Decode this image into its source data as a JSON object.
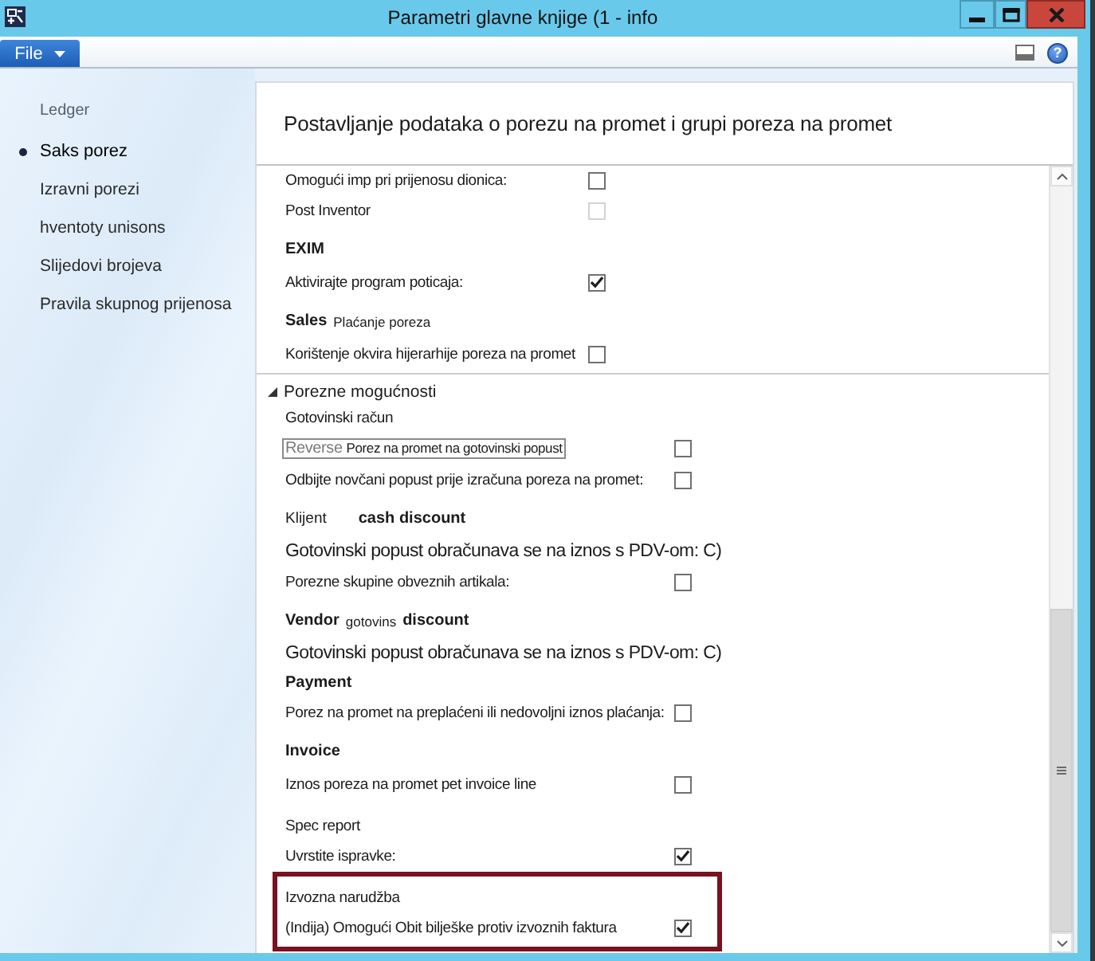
{
  "window": {
    "title": "Parametri glavne knjige (1 - info"
  },
  "ribbon": {
    "file_button": "File",
    "help_button": "?"
  },
  "sidebar": {
    "heading": "Ledger",
    "items": [
      {
        "label": "Saks porez",
        "selected": true
      },
      {
        "label": "Izravni porezi",
        "selected": false
      },
      {
        "label": "hventoty unisons",
        "selected": false
      },
      {
        "label": "Slijedovi brojeva",
        "selected": false
      },
      {
        "label": "Pravila skupnog prijenosa",
        "selected": false
      }
    ]
  },
  "content": {
    "title": "Postavljanje podataka o porezu na promet i grupi poreza na promet",
    "rows": [
      {
        "kind": "checkbox",
        "label": "Omogući imp pri prijenosu dionica:",
        "checked": false,
        "disabled": false,
        "focused": false
      },
      {
        "kind": "checkbox",
        "label": "Post Inventor",
        "checked": false,
        "disabled": true,
        "focused": false
      },
      {
        "kind": "heading",
        "parts": [
          {
            "kind": "title",
            "text": "EXIM"
          }
        ]
      },
      {
        "kind": "checkbox",
        "label": "Aktivirajte program poticaja:",
        "checked": true,
        "disabled": false,
        "focused": false
      },
      {
        "kind": "heading",
        "parts": [
          {
            "kind": "title",
            "text": "Sales"
          },
          {
            "kind": "caption",
            "text": "Plaćanje poreza"
          }
        ]
      },
      {
        "kind": "checkbox",
        "label": "Korištenje okvira hijerarhije poreza na promet",
        "checked": false,
        "disabled": false,
        "focused": false
      }
    ],
    "group": {
      "title": "Porezne mogućnosti",
      "expanded": true,
      "rows": [
        {
          "kind": "text",
          "text": "Gotovinski račun"
        },
        {
          "kind": "checkbox",
          "prefix": "Reverse",
          "label": "Porez na promet na gotovinski popust",
          "checked": false,
          "disabled": false,
          "focused": true
        },
        {
          "kind": "checkbox",
          "label": "Odbijte novčani popust prije izračuna poreza na promet:",
          "checked": false,
          "disabled": false,
          "focused": false
        },
        {
          "kind": "heading",
          "parts": [
            {
              "kind": "label",
              "text": "Klijent"
            },
            {
              "kind": "title",
              "text": "cash discount"
            }
          ]
        },
        {
          "kind": "note",
          "text": "Gotovinski popust obračunava se na iznos s PDV-om: C)"
        },
        {
          "kind": "checkbox",
          "label": "Porezne skupine obveznih artikala:",
          "checked": false,
          "disabled": false,
          "focused": false
        },
        {
          "kind": "heading",
          "parts": [
            {
              "kind": "title",
              "text": "Vendor"
            },
            {
              "kind": "caption",
              "text": "gotovins"
            },
            {
              "kind": "title",
              "text": "discount"
            }
          ]
        },
        {
          "kind": "note",
          "text": "Gotovinski popust obračunava se na iznos s PDV-om: C)"
        },
        {
          "kind": "heading",
          "parts": [
            {
              "kind": "title",
              "text": "Payment"
            }
          ]
        },
        {
          "kind": "checkbox",
          "label": "Porez na promet na preplaćeni ili nedovoljni iznos plaćanja:",
          "checked": false,
          "disabled": false,
          "focused": false
        },
        {
          "kind": "heading",
          "parts": [
            {
              "kind": "title",
              "text": "Invoice"
            }
          ]
        },
        {
          "kind": "checkbox",
          "label": "Iznos poreza na promet pet invoice line",
          "checked": false,
          "disabled": false,
          "focused": false
        },
        {
          "kind": "text",
          "text": "Spec report"
        },
        {
          "kind": "checkbox",
          "label": "Uvrstite ispravke:",
          "checked": true,
          "disabled": false,
          "focused": false
        },
        {
          "kind": "highlight",
          "rows": [
            {
              "kind": "text",
              "text": "Izvozna narudžba"
            },
            {
              "kind": "checkbox",
              "label": "(Indija) Omogući Obit bilješke protiv izvoznih faktura",
              "checked": true,
              "disabled": false,
              "focused": false
            }
          ]
        }
      ]
    }
  }
}
